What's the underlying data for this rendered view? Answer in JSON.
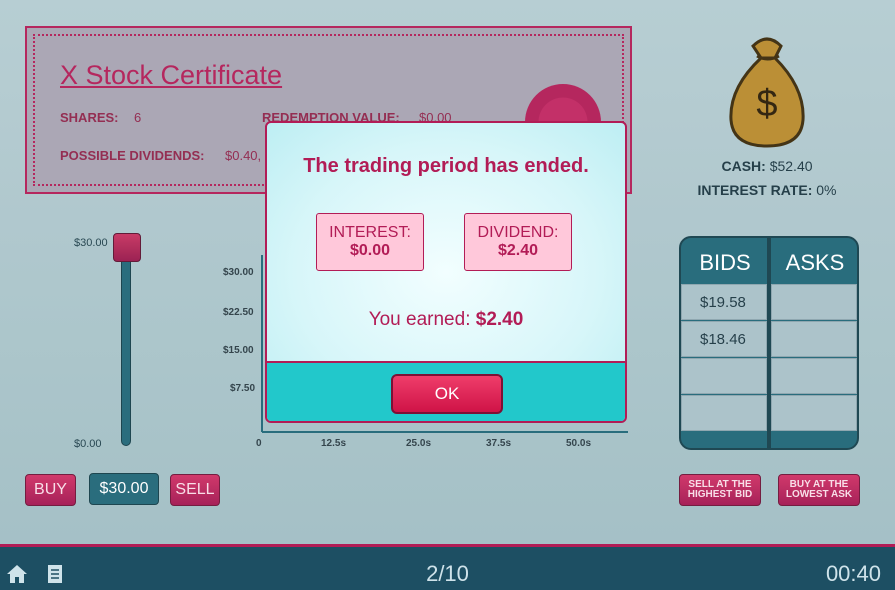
{
  "certificate": {
    "title": "X Stock Certificate",
    "shares_label": "SHARES:",
    "shares_value": "6",
    "redemption_label": "REDEMPTION VALUE:",
    "redemption_value": "$0.00",
    "dividends_label": "POSSIBLE DIVIDENDS:",
    "dividends_value": "$0.40,"
  },
  "wallet": {
    "cash_label": "CASH:",
    "cash_value": "$52.40",
    "interest_label": "INTEREST RATE:",
    "interest_value": "0%"
  },
  "slider": {
    "max_label": "$30.00",
    "min_label": "$0.00",
    "level": 1.0
  },
  "chart": {
    "y_ticks": [
      "$30.00",
      "$22.50",
      "$15.00",
      "$7.50"
    ],
    "x_ticks": [
      "0",
      "12.5s",
      "25.0s",
      "37.5s",
      "50.0s"
    ]
  },
  "trade": {
    "buy_label": "BUY",
    "price_label": "$30.00",
    "sell_label": "SELL",
    "sell_highest_label": "SELL AT THE HIGHEST BID",
    "buy_lowest_label": "BUY AT THE LOWEST ASK"
  },
  "book": {
    "bids_header": "BIDS",
    "asks_header": "ASKS",
    "bids": [
      "$19.58",
      "$18.46",
      "",
      ""
    ],
    "asks": [
      "",
      "",
      "",
      ""
    ]
  },
  "footer": {
    "round": "2/10",
    "timer": "00:40"
  },
  "modal": {
    "title": "The trading period has ended.",
    "interest_label": "INTEREST:",
    "interest_value": "$0.00",
    "dividend_label": "DIVIDEND:",
    "dividend_value": "$2.40",
    "earned_label": "You earned:",
    "earned_value": "$2.40",
    "ok_label": "OK"
  },
  "colors": {
    "brand": "#b21c56",
    "teal": "#1e6677",
    "modal_footer": "#22c8cb"
  },
  "icons": [
    "home-icon",
    "document-icon",
    "money-bag-icon",
    "seal-icon"
  ]
}
